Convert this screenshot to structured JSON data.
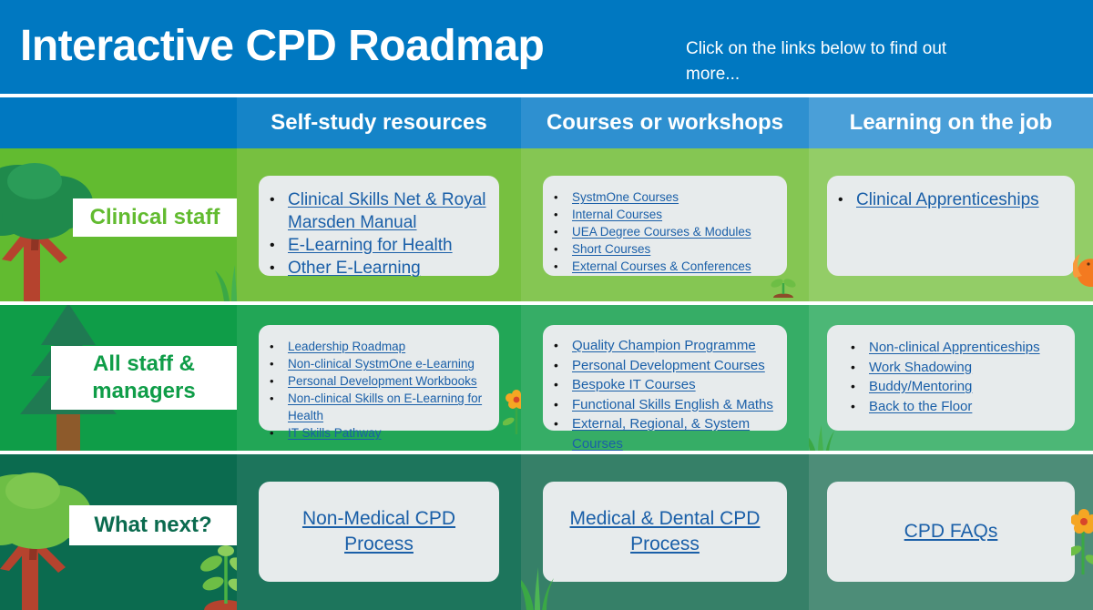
{
  "header": {
    "title": "Interactive CPD Roadmap",
    "subtitle": "Click on the links below to find out more...",
    "accent_blue": "#0078c1"
  },
  "columns": [
    {
      "label": ""
    },
    {
      "label": "Self-study resources"
    },
    {
      "label": "Courses or workshops"
    },
    {
      "label": "Learning on the job"
    }
  ],
  "rows": [
    {
      "label": "Clinical staff",
      "label_color": "#62bb30",
      "bg_color": "#62bb30",
      "decoration": "deciduous-tree",
      "cells": [
        {
          "style": "bullets-large",
          "items": [
            "Clinical Skills Net & Royal Marsden Manual",
            "E-Learning for Health",
            "Other E-Learning"
          ]
        },
        {
          "style": "bullets-small",
          "items": [
            "SystmOne Courses",
            "Internal Courses",
            "UEA Degree Courses & Modules",
            "Short Courses",
            "External Courses & Conferences"
          ]
        },
        {
          "style": "bullets-large",
          "items": [
            "Clinical Apprenticeships"
          ]
        }
      ]
    },
    {
      "label": "All staff & managers",
      "label_color": "#0f9d48",
      "bg_color": "#0f9d48",
      "decoration": "conifer-tree",
      "cells": [
        {
          "style": "bullets-small",
          "items": [
            "Leadership Roadmap",
            "Non-clinical SystmOne e-Learning",
            "Personal Development Workbooks",
            "Non-clinical Skills on E-Learning for Health",
            "IT Skills Pathway"
          ]
        },
        {
          "style": "bullets-mid",
          "items": [
            "Quality Champion Programme",
            "Personal Development Courses",
            "Bespoke IT Courses",
            "Functional Skills English & Maths",
            "External, Regional, & System Courses"
          ]
        },
        {
          "style": "bullets-mid",
          "items": [
            "Non-clinical Apprenticeships",
            "Work Shadowing",
            "Buddy/Mentoring",
            "Back to the Floor"
          ]
        }
      ]
    },
    {
      "label": "What next?",
      "label_color": "#0b6b4f",
      "bg_color": "#0b6b4f",
      "decoration": "deciduous-tree-light",
      "cells": [
        {
          "style": "centered-link",
          "items": [
            "Non-Medical CPD Process"
          ]
        },
        {
          "style": "centered-link",
          "items": [
            "Medical & Dental CPD Process"
          ]
        },
        {
          "style": "centered-link",
          "items": [
            "CPD FAQs"
          ]
        }
      ]
    }
  ],
  "decorations": {
    "tree": "tree-icon",
    "conifer": "conifer-tree-icon",
    "grass": "grass-tuft-icon",
    "sprout": "seedling-sprout-icon",
    "flower": "flower-icon",
    "squirrel": "squirrel-icon"
  },
  "link_color": "#1a5fa8"
}
